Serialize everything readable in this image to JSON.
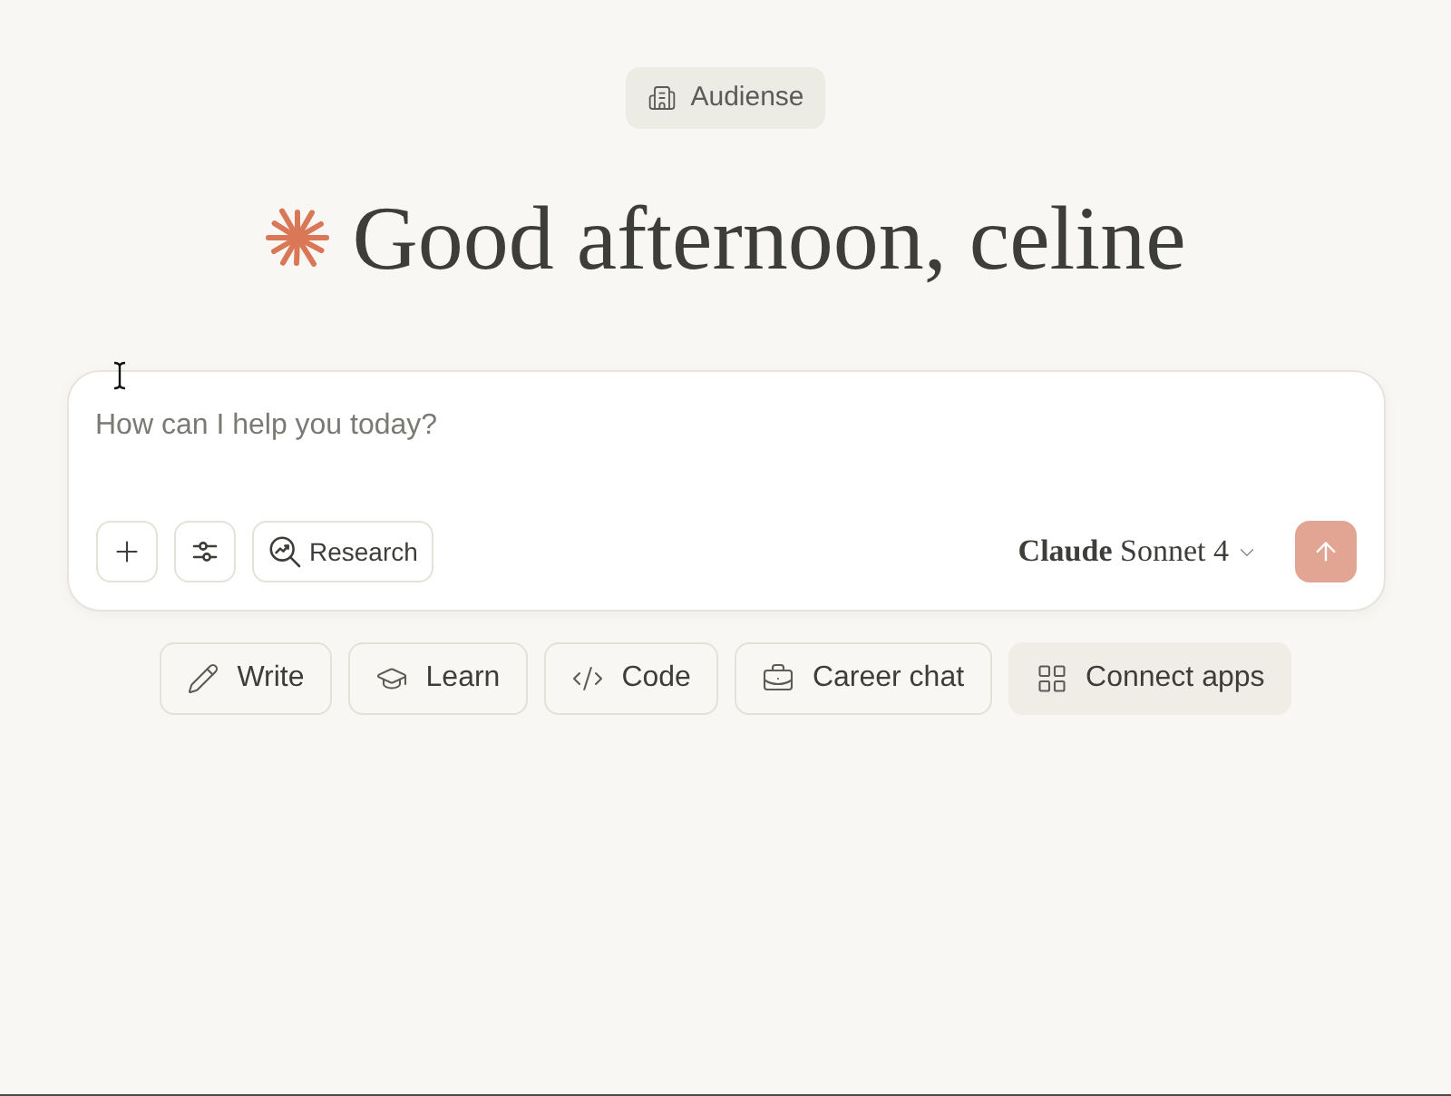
{
  "workspace_badge": {
    "label": "Audiense"
  },
  "greeting": {
    "text": "Good afternoon, celine"
  },
  "composer": {
    "placeholder": "How can I help you today?",
    "research_button": {
      "label": "Research"
    },
    "model_selector": {
      "label": "**Claude** Sonnet 4"
    },
    "send_button": {
      "disabled": true
    }
  },
  "suggestion_chips": [
    {
      "label": "Write",
      "kind": "prompt"
    },
    {
      "label": "Learn",
      "kind": "prompt"
    },
    {
      "label": "Code",
      "kind": "prompt"
    },
    {
      "label": "Career chat",
      "kind": "prompt"
    },
    {
      "label": "Connect apps",
      "kind": "connect"
    }
  ]
}
